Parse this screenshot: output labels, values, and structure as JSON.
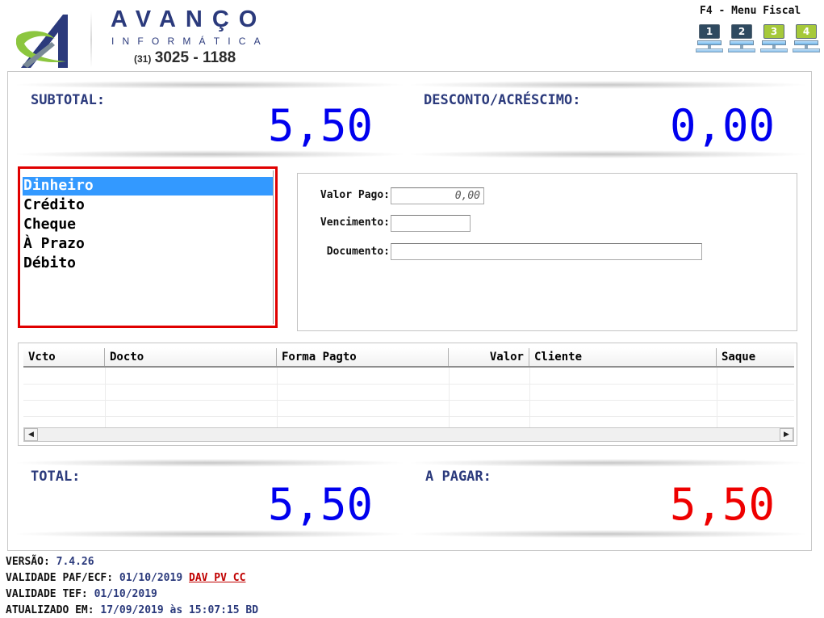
{
  "header": {
    "brand_name": "AVANÇO",
    "brand_sub": "INFORMÁTICA",
    "phone_area": "(31)",
    "phone_number": "3025 - 1188",
    "menu_fiscal_label": "F4 - Menu Fiscal",
    "terminals": [
      {
        "label": "1",
        "color": "#2f4a60"
      },
      {
        "label": "2",
        "color": "#2f4a60"
      },
      {
        "label": "3",
        "color": "#a6c93a"
      },
      {
        "label": "4",
        "color": "#a6c93a"
      }
    ]
  },
  "summary": {
    "subtotal_label": "SUBTOTAL:",
    "subtotal_value": "5,50",
    "discount_label": "DESCONTO/ACRÉSCIMO:",
    "discount_value": "0,00",
    "total_label": "TOTAL:",
    "total_value": "5,50",
    "to_pay_label": "A PAGAR:",
    "to_pay_value": "5,50"
  },
  "payment_methods": {
    "selected_index": 0,
    "items": [
      "Dinheiro",
      "Crédito",
      "Cheque",
      "À Prazo",
      "Débito"
    ]
  },
  "payment_form": {
    "valor_pago_label": "Valor Pago:",
    "valor_pago_value": "0,00",
    "vencimento_label": "Vencimento:",
    "vencimento_value": "",
    "documento_label": "Documento:",
    "documento_value": ""
  },
  "grid": {
    "columns": [
      "Vcto",
      "Docto",
      "Forma Pagto",
      "Valor",
      "Cliente",
      "Saque"
    ],
    "rows": []
  },
  "footer": {
    "versao_label": "VERSÃO:",
    "versao_value": "7.4.26",
    "validade_paf_label": "VALIDADE PAF/ECF:",
    "validade_paf_value": "01/10/2019",
    "dav_flags": "DAV PV CC",
    "validade_tef_label": "VALIDADE TEF:",
    "validade_tef_value": "01/10/2019",
    "atualizado_label": "ATUALIZADO EM:",
    "atualizado_value": "17/09/2019 às 15:07:15 BD"
  },
  "colors": {
    "blue_value": "#0000ee",
    "red_value": "#ee0000",
    "label_navy": "#2b3a7c",
    "selection": "#3399ff",
    "focus_border": "#e00000"
  }
}
